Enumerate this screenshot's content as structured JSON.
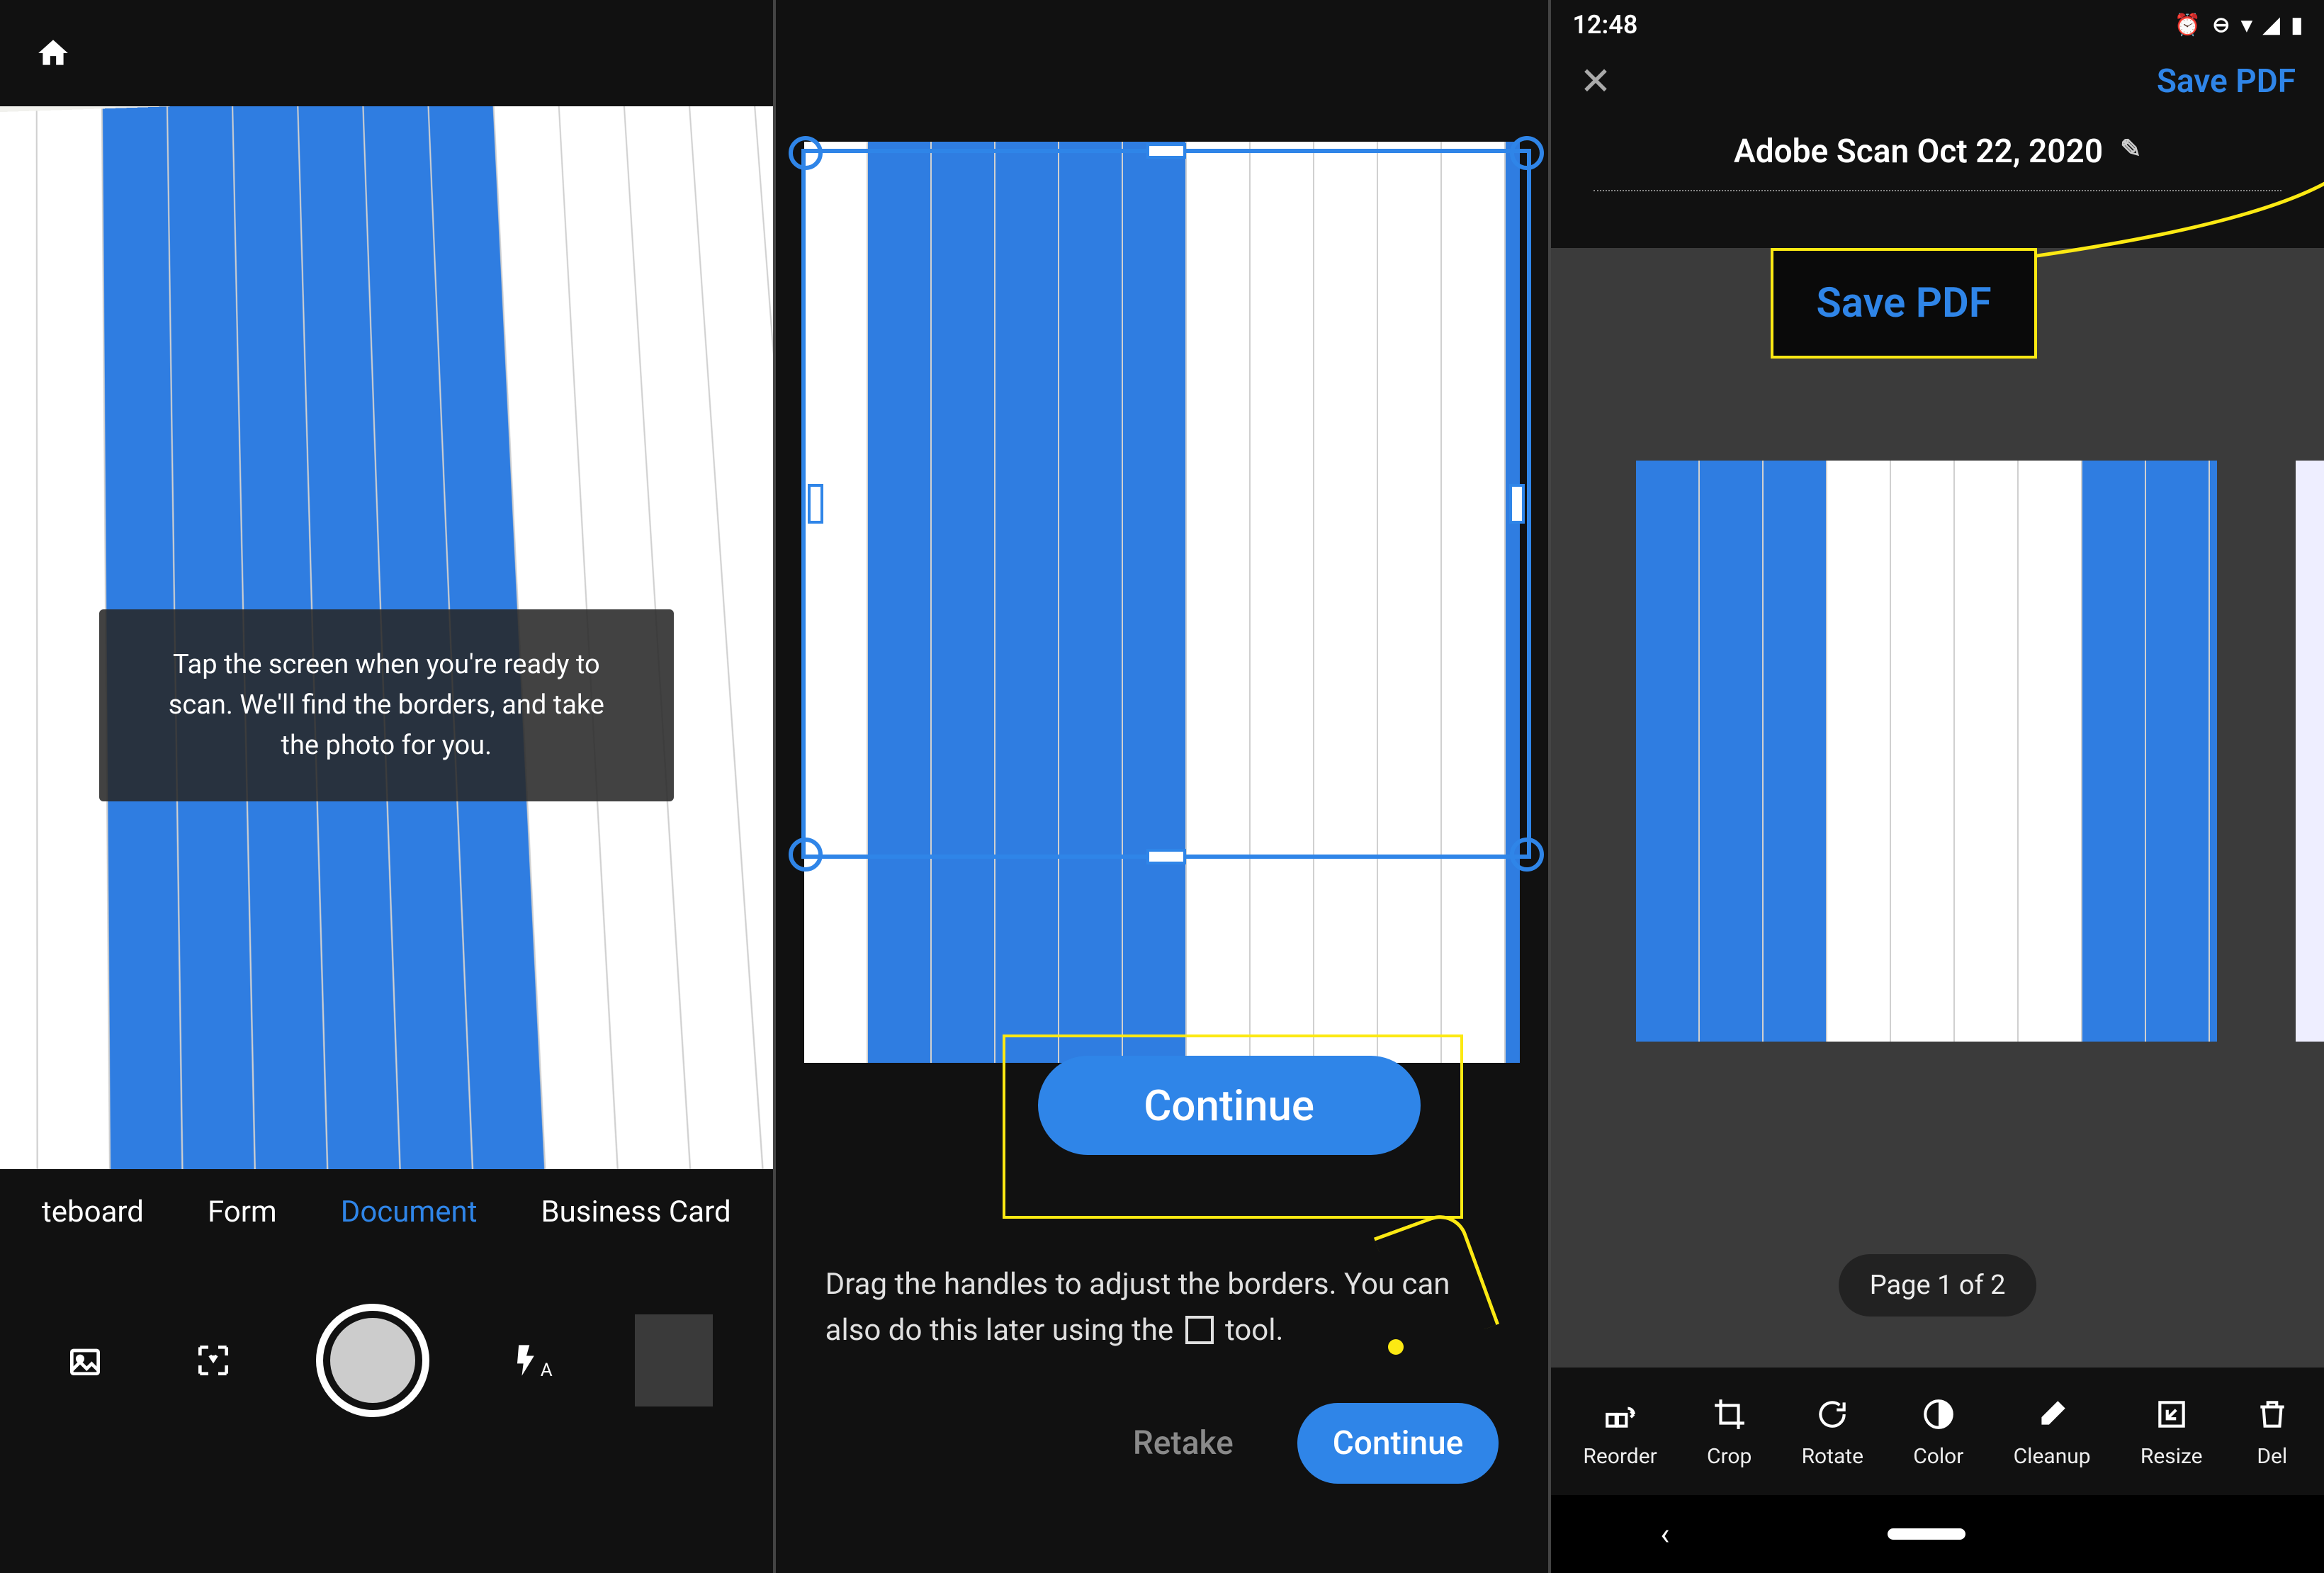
{
  "panel1": {
    "tip": "Tap the screen when you're ready to scan. We'll find the borders, and take the photo for you.",
    "modes": {
      "whiteboard": "teboard",
      "form": "Form",
      "document": "Document",
      "business_card": "Business Card"
    },
    "active_mode": "Document",
    "toolbar": {
      "gallery": "Gallery",
      "auto_capture": "Auto-Capture",
      "shutter": "Shutter",
      "flash": "Flash Auto"
    }
  },
  "panel2": {
    "continue_large": "Continue",
    "hint_1": "Drag the handles to adjust the borders. You can",
    "hint_2": "also do this later using the",
    "hint_3": "tool.",
    "retake": "Retake",
    "continue_small": "Continue"
  },
  "panel3": {
    "status": {
      "time": "12:48"
    },
    "save_pdf": "Save PDF",
    "title": "Adobe Scan Oct 22, 2020",
    "callout": "Save PDF",
    "page_badge": "Page 1 of 2",
    "tools": {
      "reorder": "Reorder",
      "crop": "Crop",
      "rotate": "Rotate",
      "color": "Color",
      "cleanup": "Cleanup",
      "resize": "Resize",
      "delete": "Del"
    }
  },
  "colors": {
    "accent": "#2f85e8",
    "highlight": "#fce913"
  }
}
